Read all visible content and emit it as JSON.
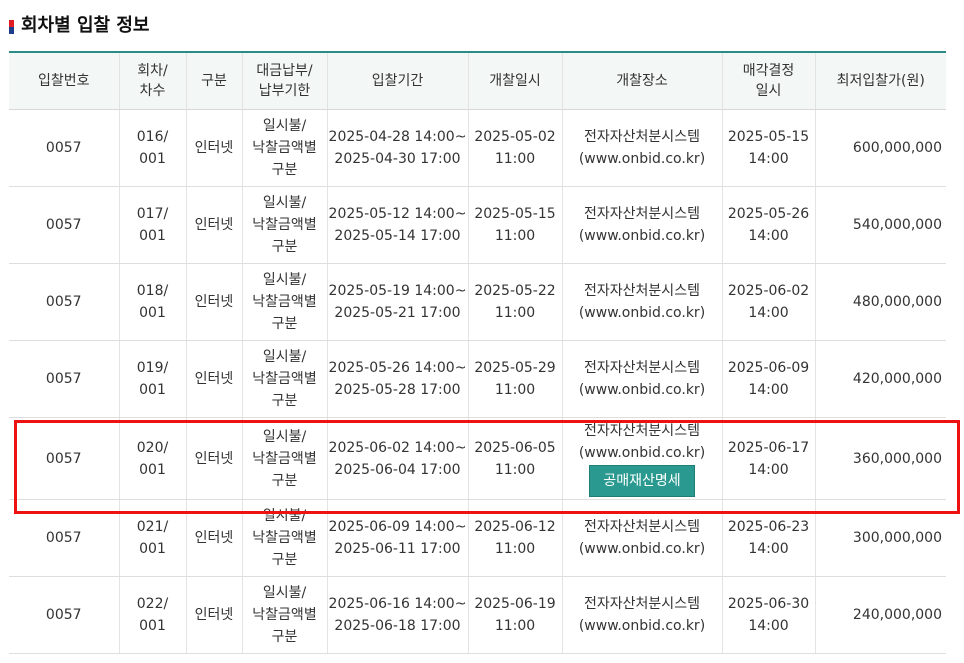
{
  "title": "회차별 입찰 정보",
  "colors": {
    "accent": "#2a8c84",
    "button": "#2a9a90",
    "highlight": "#ee1111",
    "header_bg": "#f3f8f7"
  },
  "columns": [
    [
      "입찰번호"
    ],
    [
      "회차/",
      "차수"
    ],
    [
      "구분"
    ],
    [
      "대금납부/",
      "납부기한"
    ],
    [
      "입찰기간"
    ],
    [
      "개찰일시"
    ],
    [
      "개찰장소"
    ],
    [
      "매각결정",
      "일시"
    ],
    [
      "최저입찰가(원)"
    ]
  ],
  "rows": [
    {
      "no": "0057",
      "round": [
        "016/",
        "001"
      ],
      "type": "인터넷",
      "payment": [
        "일시불/",
        "낙찰금액별",
        "구분"
      ],
      "period": [
        "2025-04-28 14:00~",
        "2025-04-30 17:00"
      ],
      "opening": [
        "2025-05-02",
        "11:00"
      ],
      "place": [
        "전자자산처분시스템",
        "(www.onbid.co.kr)"
      ],
      "decision": [
        "2025-05-15",
        "14:00"
      ],
      "price": "600,000,000"
    },
    {
      "no": "0057",
      "round": [
        "017/",
        "001"
      ],
      "type": "인터넷",
      "payment": [
        "일시불/",
        "낙찰금액별",
        "구분"
      ],
      "period": [
        "2025-05-12 14:00~",
        "2025-05-14 17:00"
      ],
      "opening": [
        "2025-05-15",
        "11:00"
      ],
      "place": [
        "전자자산처분시스템",
        "(www.onbid.co.kr)"
      ],
      "decision": [
        "2025-05-26",
        "14:00"
      ],
      "price": "540,000,000"
    },
    {
      "no": "0057",
      "round": [
        "018/",
        "001"
      ],
      "type": "인터넷",
      "payment": [
        "일시불/",
        "낙찰금액별",
        "구분"
      ],
      "period": [
        "2025-05-19 14:00~",
        "2025-05-21 17:00"
      ],
      "opening": [
        "2025-05-22",
        "11:00"
      ],
      "place": [
        "전자자산처분시스템",
        "(www.onbid.co.kr)"
      ],
      "decision": [
        "2025-06-02",
        "14:00"
      ],
      "price": "480,000,000"
    },
    {
      "no": "0057",
      "round": [
        "019/",
        "001"
      ],
      "type": "인터넷",
      "payment": [
        "일시불/",
        "낙찰금액별",
        "구분"
      ],
      "period": [
        "2025-05-26 14:00~",
        "2025-05-28 17:00"
      ],
      "opening": [
        "2025-05-29",
        "11:00"
      ],
      "place": [
        "전자자산처분시스템",
        "(www.onbid.co.kr)"
      ],
      "decision": [
        "2025-06-09",
        "14:00"
      ],
      "price": "420,000,000"
    },
    {
      "no": "0057",
      "round": [
        "020/",
        "001"
      ],
      "type": "인터넷",
      "payment": [
        "일시불/",
        "낙찰금액별",
        "구분"
      ],
      "period": [
        "2025-06-02 14:00~",
        "2025-06-04 17:00"
      ],
      "opening": [
        "2025-06-05",
        "11:00"
      ],
      "place": [
        "전자자산처분시스템",
        "(www.onbid.co.kr)"
      ],
      "decision": [
        "2025-06-17",
        "14:00"
      ],
      "price": "360,000,000",
      "button": "공매재산명세",
      "selected": true
    },
    {
      "no": "0057",
      "round": [
        "021/",
        "001"
      ],
      "type": "인터넷",
      "payment": [
        "일시불/",
        "낙찰금액별",
        "구분"
      ],
      "period": [
        "2025-06-09 14:00~",
        "2025-06-11 17:00"
      ],
      "opening": [
        "2025-06-12",
        "11:00"
      ],
      "place": [
        "전자자산처분시스템",
        "(www.onbid.co.kr)"
      ],
      "decision": [
        "2025-06-23",
        "14:00"
      ],
      "price": "300,000,000"
    },
    {
      "no": "0057",
      "round": [
        "022/",
        "001"
      ],
      "type": "인터넷",
      "payment": [
        "일시불/",
        "낙찰금액별",
        "구분"
      ],
      "period": [
        "2025-06-16 14:00~",
        "2025-06-18 17:00"
      ],
      "opening": [
        "2025-06-19",
        "11:00"
      ],
      "place": [
        "전자자산처분시스템",
        "(www.onbid.co.kr)"
      ],
      "decision": [
        "2025-06-30",
        "14:00"
      ],
      "price": "240,000,000"
    }
  ]
}
